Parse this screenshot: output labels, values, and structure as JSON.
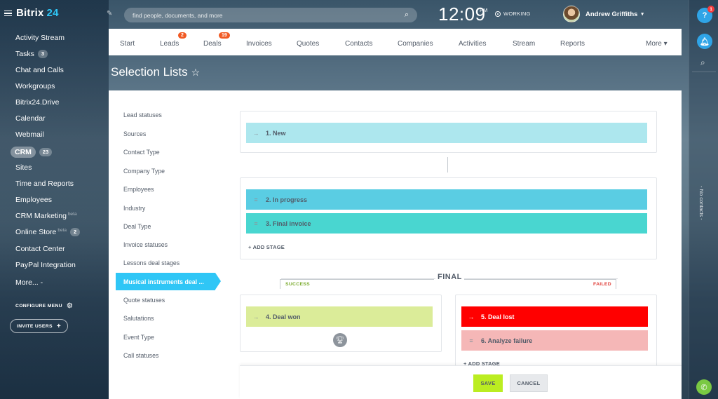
{
  "app": {
    "logo_name": "Bitrix",
    "logo_num": "24"
  },
  "sidebar": {
    "items": [
      {
        "label": "Activity Stream"
      },
      {
        "label": "Tasks",
        "badge": "3"
      },
      {
        "label": "Chat and Calls"
      },
      {
        "label": "Workgroups"
      },
      {
        "label": "Bitrix24.Drive"
      },
      {
        "label": "Calendar"
      },
      {
        "label": "Webmail"
      },
      {
        "label": "CRM",
        "badge": "23"
      },
      {
        "label": "Sites"
      },
      {
        "label": "Time and Reports"
      },
      {
        "label": "Employees"
      },
      {
        "label": "CRM Marketing",
        "beta": "beta"
      },
      {
        "label": "Online Store",
        "beta": "beta",
        "badge": "2"
      },
      {
        "label": "Contact Center"
      },
      {
        "label": "PayPal Integration"
      },
      {
        "label": "More... -"
      }
    ],
    "configure_menu": "CONFIGURE MENU",
    "invite_users": "INVITE USERS"
  },
  "topbar": {
    "search_placeholder": "find people, documents, and more",
    "clock": "12:09",
    "clock_suffix": "PM",
    "status": "WORKING",
    "user_name": "Andrew Griffiths"
  },
  "rail": {
    "help_badge": "1",
    "no_contacts": "- No contacts -"
  },
  "crm_menu": {
    "items": [
      {
        "label": "Start"
      },
      {
        "label": "Leads",
        "badge": "2"
      },
      {
        "label": "Deals",
        "badge": "19"
      },
      {
        "label": "Invoices"
      },
      {
        "label": "Quotes"
      },
      {
        "label": "Contacts"
      },
      {
        "label": "Companies"
      },
      {
        "label": "Activities"
      },
      {
        "label": "Stream"
      },
      {
        "label": "Reports"
      }
    ],
    "more": "More"
  },
  "page": {
    "title": "Selection Lists"
  },
  "lists": {
    "items": [
      "Lead statuses",
      "Sources",
      "Contact Type",
      "Company Type",
      "Employees",
      "Industry",
      "Deal Type",
      "Invoice statuses",
      "Lessons deal stages"
    ],
    "active": "Musical instruments deal ...",
    "items_after": [
      "Quote statuses",
      "Salutations",
      "Event Type",
      "Call statuses"
    ]
  },
  "stages": {
    "new": "1. New",
    "in_progress": "2. In progress",
    "final_invoice": "3. Final invoice",
    "deal_won": "4. Deal won",
    "deal_lost": "5. Deal lost",
    "analyze_failure": "6. Analyze failure",
    "add_stage": "+ ADD STAGE",
    "final": "FINAL",
    "success": "SUCCESS",
    "failed": "FAILED"
  },
  "colors": {
    "new": "#ade7ee",
    "in_progress": "#5acde3",
    "final_invoice": "#49d6d0",
    "deal_won": "#dbec99",
    "deal_lost": "#ff0000",
    "analyze_failure": "#f5b7b7"
  },
  "footer": {
    "save": "SAVE",
    "cancel": "CANCEL"
  }
}
